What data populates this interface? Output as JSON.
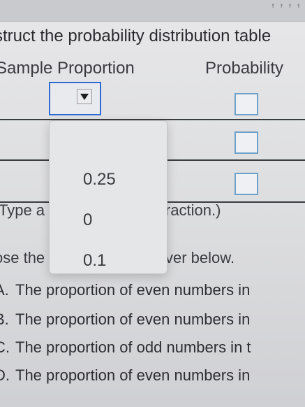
{
  "header": {
    "instruction": "struct the probability distribution table"
  },
  "table": {
    "col_sample": "Sample Proportion",
    "col_probability": "Probability"
  },
  "dropdown": {
    "selected": "",
    "options": [
      "",
      "0.25",
      "0",
      "0.1"
    ]
  },
  "hints": {
    "type_left": "Type a",
    "type_right": "raction.)",
    "choose_left": "ose the",
    "choose_right": "ver below."
  },
  "answers": [
    {
      "letter": "A.",
      "text": "The proportion of even numbers in"
    },
    {
      "letter": "B.",
      "text": "The proportion of even numbers in"
    },
    {
      "letter": "C.",
      "text": "The proportion of odd numbers in t"
    },
    {
      "letter": "D.",
      "text": "The proportion of even numbers in"
    }
  ],
  "colors": {
    "accent": "#2f6bd2",
    "input_border": "#6ea1c9"
  }
}
